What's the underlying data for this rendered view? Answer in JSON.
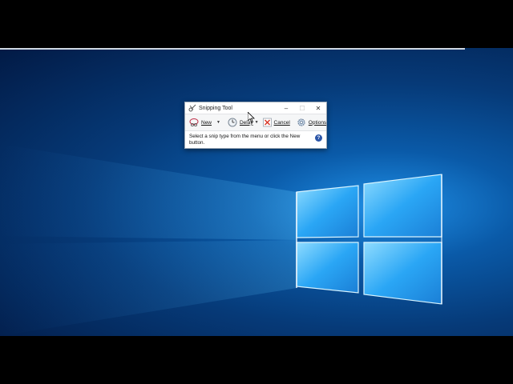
{
  "window": {
    "title": "Snipping Tool",
    "minimize_icon": "minimize-icon",
    "maximize_icon": "maximize-icon",
    "close_icon": "close-icon"
  },
  "toolbar": {
    "new_label": "New",
    "delay_label": "Delay",
    "cancel_label": "Cancel",
    "options_label": "Options"
  },
  "status": {
    "message": "Select a snip type from the menu or click the New button.",
    "help_glyph": "?"
  },
  "colors": {
    "accent": "#2c56a8",
    "desktop_blue": "#0a5aa8",
    "cancel_red": "#d93a2b"
  }
}
